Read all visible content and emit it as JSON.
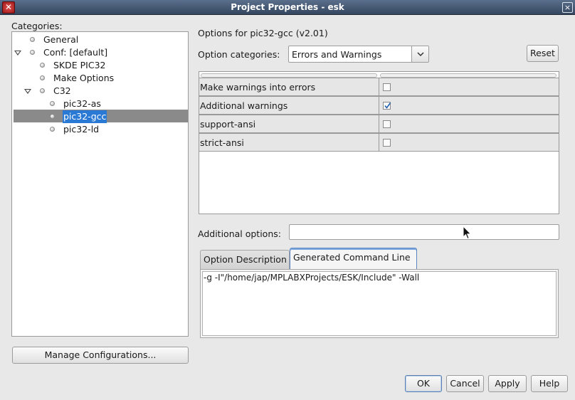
{
  "window": {
    "title": "Project Properties - esk",
    "app_icon": "x-icon",
    "close_symbol": "×"
  },
  "categories": {
    "label": "Categories:",
    "tree": [
      {
        "label": "General"
      },
      {
        "label": "Conf: [default]",
        "expanded": true
      },
      {
        "label": "SKDE PIC32"
      },
      {
        "label": "Make Options"
      },
      {
        "label": "C32",
        "expanded": true
      },
      {
        "label": "pic32-as"
      },
      {
        "label": "pic32-gcc",
        "selected": true
      },
      {
        "label": "pic32-ld"
      }
    ]
  },
  "manage_button": "Manage Configurations...",
  "options": {
    "header": "Options for pic32-gcc (v2.01)",
    "category_label": "Option categories:",
    "category_value": "Errors and Warnings",
    "reset_label": "Reset",
    "rows": [
      {
        "name": "Make warnings into errors",
        "checked": false
      },
      {
        "name": "Additional warnings",
        "checked": true
      },
      {
        "name": "support-ansi",
        "checked": false
      },
      {
        "name": "strict-ansi",
        "checked": false
      }
    ],
    "additional_label": "Additional options:",
    "additional_value": ""
  },
  "tabs": {
    "items": [
      "Option Description",
      "Generated Command Line"
    ],
    "active": "Generated Command Line",
    "command_line": "-g -I\"/home/jap/MPLABXProjects/ESK/Include\" -Wall"
  },
  "footer": {
    "ok": "OK",
    "cancel": "Cancel",
    "apply": "Apply",
    "help": "Help"
  },
  "colors": {
    "selection": "#2a7ad5",
    "titlebar": "#3f5470"
  }
}
